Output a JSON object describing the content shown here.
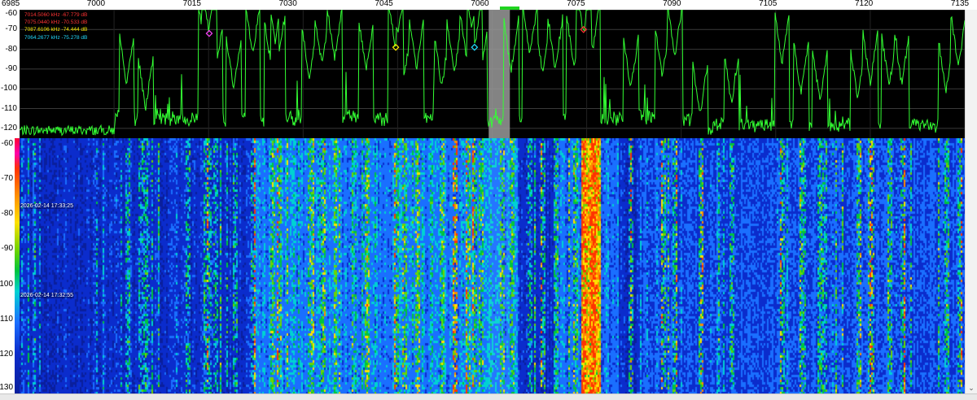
{
  "freq_axis": {
    "ticks": [
      "6985",
      "7000",
      "7015",
      "7030",
      "7045",
      "7060",
      "7075",
      "7090",
      "7105",
      "7120",
      "7135"
    ],
    "min_khz": 6985,
    "max_khz": 7135
  },
  "spectrum": {
    "y_ticks": [
      "-60",
      "-70",
      "-80",
      "-90",
      "-100",
      "-110",
      "-120"
    ],
    "y_min": -125,
    "y_max": -60,
    "noise_floor_db": -121,
    "passband_khz": [
      7061,
      7063
    ],
    "peaks": [
      {
        "freq_khz": 7002,
        "db": -98
      },
      {
        "freq_khz": 7005,
        "db": -110
      },
      {
        "freq_khz": 7014.5,
        "db": -82
      },
      {
        "freq_khz": 7015.1,
        "db": -72
      },
      {
        "freq_khz": 7016,
        "db": -95
      },
      {
        "freq_khz": 7019,
        "db": -100
      },
      {
        "freq_khz": 7022,
        "db": -83
      },
      {
        "freq_khz": 7025,
        "db": -90
      },
      {
        "freq_khz": 7026,
        "db": -87
      },
      {
        "freq_khz": 7031,
        "db": -95
      },
      {
        "freq_khz": 7033,
        "db": -88
      },
      {
        "freq_khz": 7035,
        "db": -85
      },
      {
        "freq_khz": 7040,
        "db": -91
      },
      {
        "freq_khz": 7044.7,
        "db": -80
      },
      {
        "freq_khz": 7046,
        "db": -95
      },
      {
        "freq_khz": 7048,
        "db": -90
      },
      {
        "freq_khz": 7052,
        "db": -99
      },
      {
        "freq_khz": 7054,
        "db": -92
      },
      {
        "freq_khz": 7056,
        "db": -86
      },
      {
        "freq_khz": 7057.2,
        "db": -79
      },
      {
        "freq_khz": 7058,
        "db": -96
      },
      {
        "freq_khz": 7063,
        "db": -91
      },
      {
        "freq_khz": 7066,
        "db": -83
      },
      {
        "freq_khz": 7068,
        "db": -92
      },
      {
        "freq_khz": 7070,
        "db": -90
      },
      {
        "freq_khz": 7073,
        "db": -89
      },
      {
        "freq_khz": 7074.5,
        "db": -73
      },
      {
        "freq_khz": 7076,
        "db": -80
      },
      {
        "freq_khz": 7082,
        "db": -100
      },
      {
        "freq_khz": 7087,
        "db": -94
      },
      {
        "freq_khz": 7089,
        "db": -83
      },
      {
        "freq_khz": 7093,
        "db": -113
      },
      {
        "freq_khz": 7098,
        "db": -108
      },
      {
        "freq_khz": 7106,
        "db": -87
      },
      {
        "freq_khz": 7109,
        "db": -102
      },
      {
        "freq_khz": 7112,
        "db": -106
      },
      {
        "freq_khz": 7118,
        "db": -105
      },
      {
        "freq_khz": 7120,
        "db": -97
      },
      {
        "freq_khz": 7123,
        "db": -99
      },
      {
        "freq_khz": 7125,
        "db": -98
      },
      {
        "freq_khz": 7132,
        "db": -101
      },
      {
        "freq_khz": 7134,
        "db": -89
      }
    ],
    "markers": [
      {
        "freq_khz": 7015.1,
        "db": -72,
        "color": "#ff44ff"
      },
      {
        "freq_khz": 7074.5,
        "db": -70,
        "color": "#ff3333"
      },
      {
        "freq_khz": 7044.7,
        "db": -79,
        "color": "#ffee00"
      },
      {
        "freq_khz": 7057.2,
        "db": -79,
        "color": "#22ddff"
      }
    ],
    "legend": [
      {
        "text": "7014.5060 kHz  -67.779 dB",
        "color": "#ff3333"
      },
      {
        "text": "7075.0440 kHz  -70.533 dB",
        "color": "#ff3333"
      },
      {
        "text": "7087.6106 kHz  -74.444 dB",
        "color": "#ffee00"
      },
      {
        "text": "7064.2677 kHz  -75.278 dB",
        "color": "#22ddff"
      }
    ],
    "colors": {
      "trace": "#33ff33",
      "grid": "#3a3a3a",
      "background": "#000000",
      "passband": "#9a9a9a"
    }
  },
  "waterfall": {
    "y_ticks": [
      "-60",
      "-70",
      "-80",
      "-90",
      "-100",
      "-110",
      "-120",
      "-130"
    ],
    "timestamps": [
      {
        "text": "2026-02-14 17:33:25",
        "row": 0.27
      },
      {
        "text": "2026-02-14 17:32:55",
        "row": 0.62
      }
    ],
    "palette": [
      "#0a1f9c",
      "#0b2ccc",
      "#1a6fff",
      "#00d2d2",
      "#00c43f",
      "#6cd400",
      "#ffe000",
      "#ff8a00",
      "#ff3300"
    ]
  },
  "scrollbar": {
    "arrow_icon": "chevron-down-icon",
    "arrow_glyph": "⌄"
  }
}
